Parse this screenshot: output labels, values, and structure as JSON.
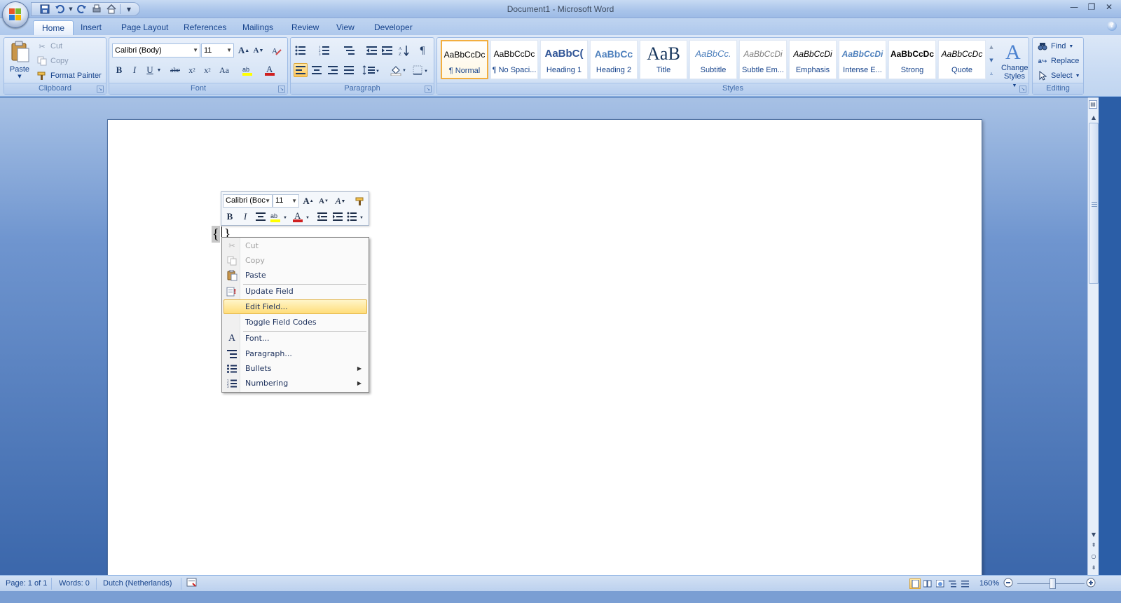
{
  "window": {
    "title": "Document1 - Microsoft Word"
  },
  "quick_access": {
    "icons": [
      "save-icon",
      "undo-icon",
      "redo-icon",
      "print-preview-icon",
      "home-icon",
      "customize-qat-icon"
    ]
  },
  "tabs": [
    {
      "label": "Home",
      "active": true
    },
    {
      "label": "Insert"
    },
    {
      "label": "Page Layout"
    },
    {
      "label": "References"
    },
    {
      "label": "Mailings"
    },
    {
      "label": "Review"
    },
    {
      "label": "View"
    },
    {
      "label": "Developer"
    }
  ],
  "ribbon": {
    "clipboard": {
      "label": "Clipboard",
      "paste": "Paste",
      "cut": "Cut",
      "copy": "Copy",
      "format_painter": "Format Painter"
    },
    "font": {
      "label": "Font",
      "font_name": "Calibri (Body)",
      "font_size": "11",
      "bold": "B",
      "italic": "I",
      "underline": "U",
      "strike": "abe",
      "grow": "A",
      "shrink": "A",
      "case": "Aa"
    },
    "paragraph": {
      "label": "Paragraph"
    },
    "styles": {
      "label": "Styles",
      "items": [
        {
          "sample": "AaBbCcDc",
          "name": "¶ Normal",
          "selected": true
        },
        {
          "sample": "AaBbCcDc",
          "name": "¶ No Spaci..."
        },
        {
          "sample": "AaBbC(",
          "name": "Heading 1"
        },
        {
          "sample": "AaBbCc",
          "name": "Heading 2"
        },
        {
          "sample": "AaB",
          "name": "Title"
        },
        {
          "sample": "AaBbCc.",
          "name": "Subtitle"
        },
        {
          "sample": "AaBbCcDi",
          "name": "Subtle Em..."
        },
        {
          "sample": "AaBbCcDi",
          "name": "Emphasis"
        },
        {
          "sample": "AaBbCcDi",
          "name": "Intense E..."
        },
        {
          "sample": "AaBbCcDc",
          "name": "Strong"
        },
        {
          "sample": "AaBbCcDc",
          "name": "Quote"
        }
      ],
      "change_styles_line1": "Change",
      "change_styles_line2": "Styles"
    },
    "editing": {
      "label": "Editing",
      "find": "Find",
      "replace": "Replace",
      "select": "Select"
    }
  },
  "document": {
    "field_open": "{",
    "field_close": "}"
  },
  "mini_toolbar": {
    "font_name": "Calibri (Boc",
    "font_size": "11",
    "bold": "B",
    "italic": "I"
  },
  "context_menu": {
    "items": [
      {
        "label": "Cut",
        "icon": "scissors-icon",
        "disabled": true
      },
      {
        "label": "Copy",
        "icon": "copy-icon",
        "disabled": true
      },
      {
        "label": "Paste",
        "icon": "paste-icon"
      },
      {
        "label": "Update Field",
        "icon": "update-field-icon"
      },
      {
        "label": "Edit Field...",
        "highlighted": true
      },
      {
        "label": "Toggle Field Codes"
      },
      {
        "label": "Font...",
        "icon": "font-icon"
      },
      {
        "label": "Paragraph...",
        "icon": "paragraph-icon"
      },
      {
        "label": "Bullets",
        "icon": "bullets-icon",
        "submenu": true
      },
      {
        "label": "Numbering",
        "icon": "numbering-icon",
        "submenu": true
      }
    ]
  },
  "statusbar": {
    "page": "Page: 1 of 1",
    "words": "Words: 0",
    "language": "Dutch (Netherlands)",
    "zoom": "160%"
  },
  "colors": {
    "accent": "#15428b",
    "highlight": "#ffdd7a",
    "frame": "#2b5ea7"
  }
}
